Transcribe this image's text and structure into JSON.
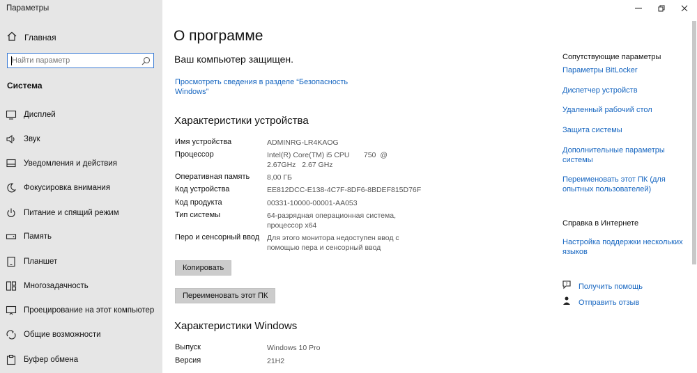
{
  "window": {
    "title": "Параметры"
  },
  "sidebar": {
    "home_label": "Главная",
    "search_placeholder": "Найти параметр",
    "section_title": "Система",
    "items": [
      {
        "icon": "monitor-icon",
        "label": "Дисплей"
      },
      {
        "icon": "speaker-icon",
        "label": "Звук"
      },
      {
        "icon": "notification-icon",
        "label": "Уведомления и действия"
      },
      {
        "icon": "moon-icon",
        "label": "Фокусировка внимания"
      },
      {
        "icon": "power-icon",
        "label": "Питание и спящий режим"
      },
      {
        "icon": "storage-icon",
        "label": "Память"
      },
      {
        "icon": "tablet-icon",
        "label": "Планшет"
      },
      {
        "icon": "multitasking-icon",
        "label": "Многозадачность"
      },
      {
        "icon": "projection-icon",
        "label": "Проецирование на этот компьютер"
      },
      {
        "icon": "shared-experiences-icon",
        "label": "Общие возможности"
      },
      {
        "icon": "clipboard-icon",
        "label": "Буфер обмена"
      }
    ]
  },
  "main": {
    "title": "О программе",
    "protected_text": "Ваш компьютер защищен.",
    "security_link": "Просмотреть сведения в разделе “Безопасность Windows”",
    "device_specs_title": "Характеристики устройства",
    "device_specs": [
      {
        "key": "Имя устройства",
        "value": "ADMINRG-LR4KAOG"
      },
      {
        "key": "Процессор",
        "value": "Intel(R) Core(TM) i5 CPU       750  @ 2.67GHz   2.67 GHz"
      },
      {
        "key": "Оперативная память",
        "value": "8,00 ГБ"
      },
      {
        "key": "Код устройства",
        "value": "EE812DCC-E138-4C7F-8DF6-8BDEF815D76F"
      },
      {
        "key": "Код продукта",
        "value": "00331-10000-00001-AA053"
      },
      {
        "key": "Тип системы",
        "value": "64-разрядная операционная система, процессор x64"
      },
      {
        "key": "Перо и сенсорный ввод",
        "value": "Для этого монитора недоступен ввод с помощью пера и сенсорный ввод"
      }
    ],
    "copy_button": "Копировать",
    "rename_button": "Переименовать этот ПК",
    "windows_specs_title": "Характеристики Windows",
    "windows_specs": [
      {
        "key": "Выпуск",
        "value": "Windows 10 Pro"
      },
      {
        "key": "Версия",
        "value": "21H2"
      }
    ]
  },
  "related": {
    "title": "Сопутствующие параметры",
    "links": [
      "Параметры BitLocker",
      "Диспетчер устройств",
      "Удаленный рабочий стол",
      "Защита системы",
      "Дополнительные параметры системы",
      "Переименовать этот ПК (для опытных пользователей)"
    ]
  },
  "web_help": {
    "title": "Справка в Интернете",
    "link": "Настройка поддержки нескольких языков"
  },
  "help": {
    "get_help": "Получить помощь",
    "feedback": "Отправить отзыв"
  },
  "colors": {
    "accent": "#1565c0",
    "sidebar_bg": "#e6e6e6",
    "button_bg": "#cccccc"
  }
}
